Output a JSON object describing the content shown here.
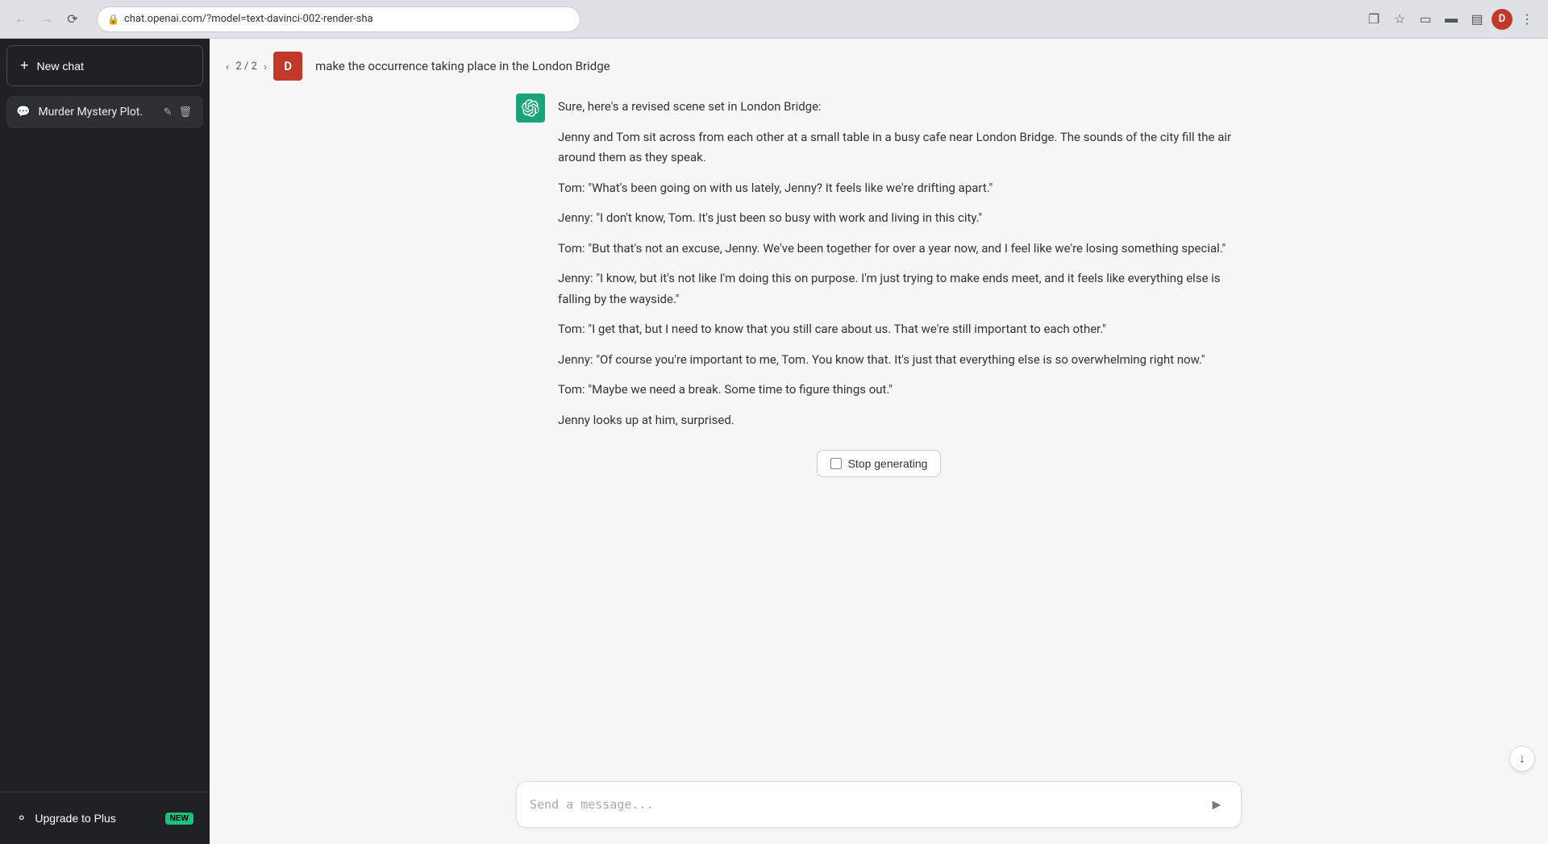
{
  "browser": {
    "url": "chat.openai.com/?model=text-davinci-002-render-sha",
    "back_disabled": true,
    "forward_disabled": true,
    "profile_initial": "D"
  },
  "sidebar": {
    "new_chat_label": "New chat",
    "chat_history": [
      {
        "label": "Murder Mystery Plot.",
        "id": "murder-mystery"
      }
    ],
    "upgrade_label": "Upgrade to Plus",
    "new_badge": "NEW"
  },
  "message_nav": {
    "counter": "2 / 2",
    "user_initial": "D",
    "user_message": "make the occurrence taking place in the London Bridge"
  },
  "assistant_response": {
    "intro": "Sure, here's a revised scene set in London Bridge:",
    "paragraphs": [
      "Jenny and Tom sit across from each other at a small table in a busy cafe near London Bridge. The sounds of the city fill the air around them as they speak.",
      "Tom: \"What's been going on with us lately, Jenny? It feels like we're drifting apart.\"",
      "Jenny: \"I don't know, Tom. It's just been so busy with work and living in this city.\"",
      "Tom: \"But that's not an excuse, Jenny. We've been together for over a year now, and I feel like we're losing something special.\"",
      "Jenny: \"I know, but it's not like I'm doing this on purpose. I'm just trying to make ends meet, and it feels like everything else is falling by the wayside.\"",
      "Tom: \"I get that, but I need to know that you still care about us. That we're still important to each other.\"",
      "Jenny: \"Of course you're important to me, Tom. You know that. It's just that everything else is so overwhelming right now.\"",
      "Tom: \"Maybe we need a break. Some time to figure things out.\"",
      "Jenny looks up at him, surprised."
    ]
  },
  "stop_button": {
    "label": "Stop generating"
  },
  "input": {
    "placeholder": "Send a message..."
  },
  "icons": {
    "send": "▸",
    "scroll_down": "↓"
  }
}
